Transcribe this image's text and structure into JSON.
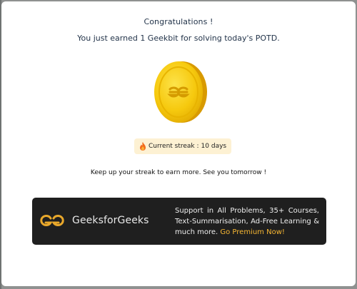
{
  "modal": {
    "title": "Congratulations !",
    "subtitle": "You just earned 1 Geekbit for solving today's POTD.",
    "coin_icon": "geekbit-coin-icon",
    "streak": {
      "icon": "fire-icon",
      "label": "Current streak : ",
      "value": "10 days"
    },
    "message": "Keep up your streak to earn more. See you tomorrow !"
  },
  "banner": {
    "logo": "gfg-logo-icon",
    "brand": "GeeksforGeeks",
    "promo_text": "Support in All Problems, 35+ Courses, Text-Summarisation, Ad-Free Learning & much more.",
    "cta": "Go Premium Now!"
  },
  "colors": {
    "backdrop": "#8f9190",
    "modal_bg": "#ffffff",
    "title_text": "#23344a",
    "coin_gold": "#f6c90e",
    "streak_pill": "#fdf1d3",
    "banner_bg": "#1f1f1f",
    "cta_accent": "#f7b733"
  }
}
